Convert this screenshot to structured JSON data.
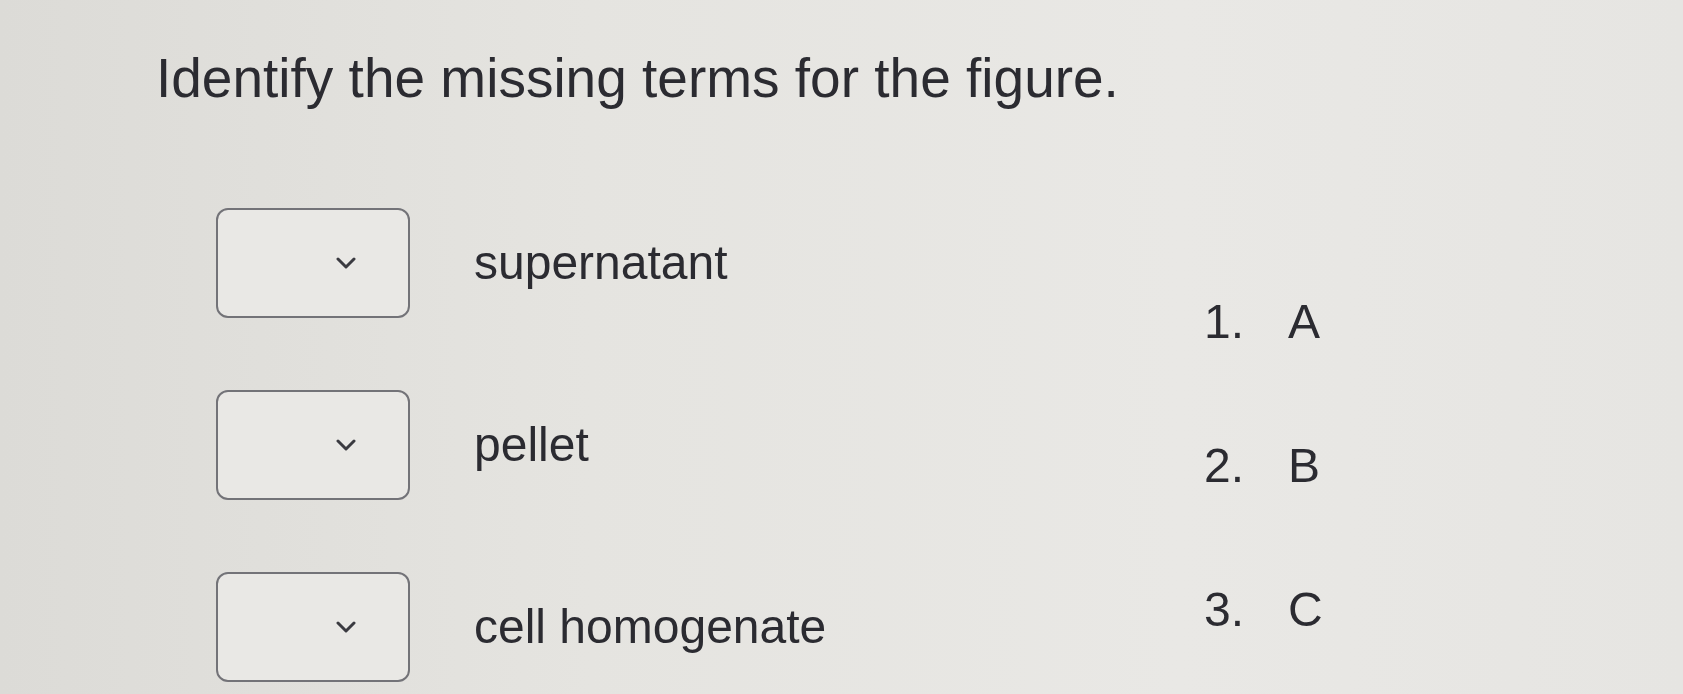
{
  "question": {
    "title": "Identify the missing terms for the figure."
  },
  "answers": [
    {
      "term": "supernatant"
    },
    {
      "term": "pellet"
    },
    {
      "term": "cell homogenate"
    }
  ],
  "key": [
    {
      "number": "1.",
      "label": "A"
    },
    {
      "number": "2.",
      "label": "B"
    },
    {
      "number": "3.",
      "label": "C"
    }
  ]
}
